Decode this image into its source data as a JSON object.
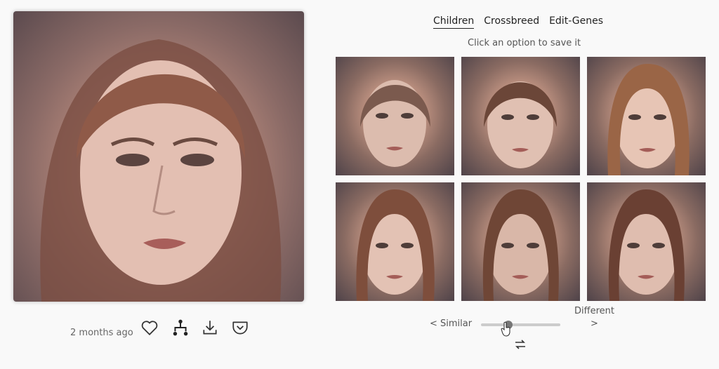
{
  "main_image": {
    "icon": "portrait-image"
  },
  "meta": {
    "timestamp": "2 months ago",
    "actions": [
      {
        "name": "like",
        "icon": "heart-icon"
      },
      {
        "name": "family-tree",
        "icon": "tree-icon"
      },
      {
        "name": "download",
        "icon": "download-icon"
      },
      {
        "name": "save",
        "icon": "pocket-save-icon"
      }
    ]
  },
  "tabs": [
    {
      "label": "Children",
      "active": true
    },
    {
      "label": "Crossbreed",
      "active": false
    },
    {
      "label": "Edit-Genes",
      "active": false
    }
  ],
  "hint": "Click an option to save it",
  "children": [
    {
      "icon": "portrait-thumbnail"
    },
    {
      "icon": "portrait-thumbnail"
    },
    {
      "icon": "portrait-thumbnail"
    },
    {
      "icon": "portrait-thumbnail"
    },
    {
      "icon": "portrait-thumbnail"
    },
    {
      "icon": "portrait-thumbnail"
    }
  ],
  "variation": {
    "similar_label": "< Similar",
    "different_label": "Different",
    "different_arrow": ">",
    "level": 0.33
  }
}
